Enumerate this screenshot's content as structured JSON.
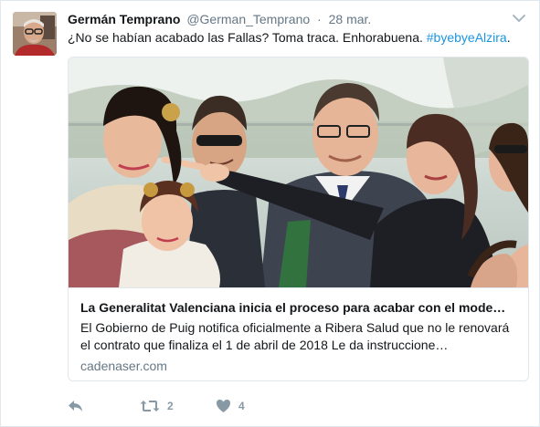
{
  "tweet": {
    "author_name": "Germán Temprano",
    "author_handle": "@German_Temprano",
    "separator": "·",
    "timestamp": "28 mar.",
    "text_main": "¿No se habían acabado las Fallas? Toma traca. Enhorabuena. ",
    "text_hashtag": "#byebyeAlzira",
    "text_end": "."
  },
  "card": {
    "title": "La Generalitat Valenciana inicia el proceso para acabar con el mode…",
    "description": "El Gobierno de Puig notifica oficialmente a Ribera Salud que no le renovará el contrato que finaliza el 1 de abril de 2018 Le da instruccione…",
    "domain": "cadenaser.com"
  },
  "actions": {
    "reply_icon": "reply-icon",
    "retweet_icon": "retweet-icon",
    "retweet_count": "2",
    "like_icon": "heart-icon",
    "like_count": "4"
  },
  "colors": {
    "hashtag": "#1b95e0",
    "secondary_text": "#657786",
    "action_icons": "#8899a6",
    "border": "#e1e8ed"
  }
}
